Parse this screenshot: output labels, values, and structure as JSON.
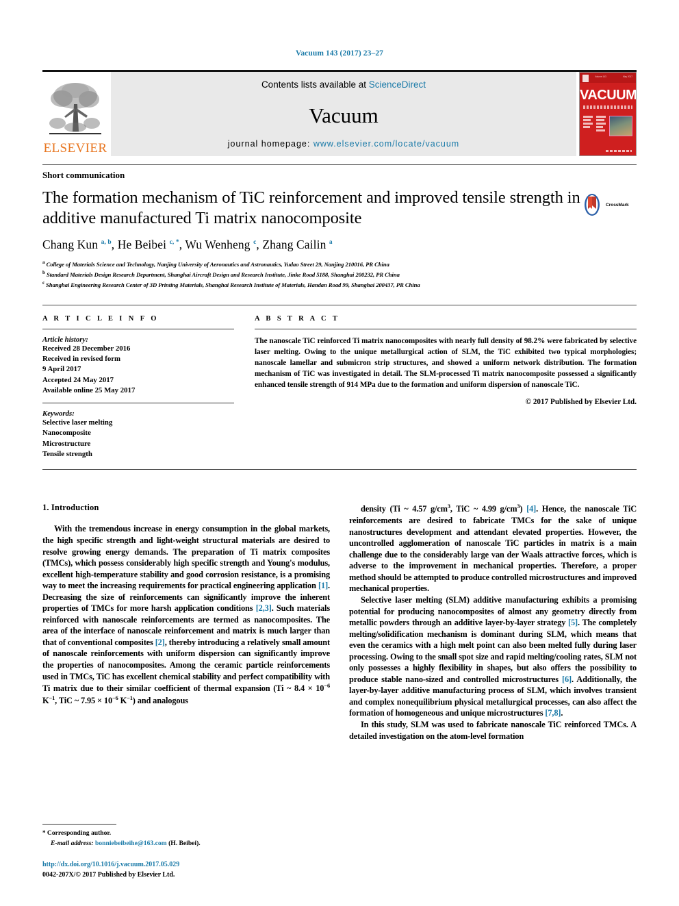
{
  "masthead": {
    "citation": "Vacuum 143 (2017) 23–27"
  },
  "journal_header": {
    "publisher_name": "ELSEVIER",
    "contents_prefix": "Contents lists available at ",
    "sciencedirect": "ScienceDirect",
    "journal_title": "Vacuum",
    "homepage_label": "journal homepage: ",
    "homepage_url": "www.elsevier.com/locate/vacuum",
    "cover_title": "VACUUM",
    "accent_blue": "#1a7aa8",
    "elsevier_orange": "#E87722",
    "cover_red": "#cf1f1f"
  },
  "article": {
    "type": "Short communication",
    "title": "The formation mechanism of TiC reinforcement and improved tensile strength in additive manufactured Ti matrix nanocomposite",
    "crossmark_label": "CrossMark",
    "authors_html": "Chang Kun <sup>a, b</sup>, He Beibei <sup>c, *</sup>, Wu Wenheng <sup>c</sup>, Zhang Cailin <sup>a</sup>",
    "affiliations": [
      {
        "marker": "a",
        "text": "College of Materials Science and Technology, Nanjing University of Aeronautics and Astronautics, Yudao Street 29, Nanjing 210016, PR China"
      },
      {
        "marker": "b",
        "text": "Standard Materials Design Research Department, Shanghai Aircraft Design and Research Institute, Jinke Road 5188, Shanghai 200232, PR China"
      },
      {
        "marker": "c",
        "text": "Shanghai Engineering Research Center of 3D Printing Materials, Shanghai Research Institute of Materials, Handan Road 99, Shanghai 200437, PR China"
      }
    ]
  },
  "article_info": {
    "heading": "A R T I C L E  I N F O",
    "history_label": "Article history:",
    "history": [
      "Received 28 December 2016",
      "Received in revised form",
      "9 April 2017",
      "Accepted 24 May 2017",
      "Available online 25 May 2017"
    ],
    "keywords_label": "Keywords:",
    "keywords": [
      "Selective laser melting",
      "Nanocomposite",
      "Microstructure",
      "Tensile strength"
    ]
  },
  "abstract": {
    "heading": "A B S T R A C T",
    "text": "The nanoscale TiC reinforced Ti matrix nanocomposites with nearly full density of 98.2% were fabricated by selective laser melting. Owing to the unique metallurgical action of SLM, the TiC exhibited two typical morphologies; nanoscale lamellar and submicron strip structures, and showed a uniform network distribution. The formation mechanism of TiC was investigated in detail. The SLM-processed Ti matrix nanocomposite possessed a significantly enhanced tensile strength of 914 MPa due to the formation and uniform dispersion of nanoscale TiC.",
    "copyright": "© 2017 Published by Elsevier Ltd."
  },
  "body": {
    "section_number_title": "1.  Introduction",
    "left_paragraph_1_html": "With the tremendous increase in energy consumption in the global markets, the high specific strength and light-weight structural materials are desired to resolve growing energy demands. The preparation of Ti matrix composites (TMCs), which possess considerably high specific strength and Young's modulus, excellent high-temperature stability and good corrosion resistance, is a promising way to meet the increasing requirements for practical engineering application <span class=\"ref\">[1]</span>. Decreasing the size of reinforcements can significantly improve the inherent properties of TMCs for more harsh application conditions <span class=\"ref\">[2,3]</span>. Such materials reinforced with nanoscale reinforcements are termed as nanocomposites. The area of the interface of nanoscale reinforcement and matrix is much larger than that of conventional composites <span class=\"ref\">[2]</span>, thereby introducing a relatively small amount of nanoscale reinforcements with uniform dispersion can significantly improve the properties of nanocomposites. Among the ceramic particle reinforcements used in TMCs, TiC has excellent chemical stability and perfect compatibility with Ti matrix due to their similar coefficient of thermal expansion (Ti ~ 8.4 &#215; 10<sup>&#8722;6</sup> K<sup>&#8722;1</sup>, TiC ~ 7.95 &#215; 10<sup>&#8722;6</sup> K<sup>&#8722;1</sup>) and analogous",
    "right_paragraph_1_html": "density (Ti ~ 4.57 g/cm<sup>3</sup>, TiC ~ 4.99 g/cm<sup>3</sup>) <span class=\"ref\">[4]</span>. Hence, the nanoscale TiC reinforcements are desired to fabricate TMCs for the sake of unique nanostructures development and attendant elevated properties. However, the uncontrolled agglomeration of nanoscale TiC particles in matrix is a main challenge due to the considerably large van der Waals attractive forces, which is adverse to the improvement in mechanical properties. Therefore, a proper method should be attempted to produce controlled microstructures and improved mechanical properties.",
    "right_paragraph_2_html": "Selective laser melting (SLM) additive manufacturing exhibits a promising potential for producing nanocomposites of almost any geometry directly from metallic powders through an additive layer-by-layer strategy <span class=\"ref\">[5]</span>. The completely melting/solidification mechanism is dominant during SLM, which means that even the ceramics with a high melt point can also been melted fully during laser processing. Owing to the small spot size and rapid melting/cooling rates, SLM not only possesses a highly flexibility in shapes, but also offers the possibility to produce stable nano-sized and controlled microstructures <span class=\"ref\">[6]</span>. Additionally, the layer-by-layer additive manufacturing process of SLM, which involves transient and complex nonequilibrium physical metallurgical processes, can also affect the formation of homogeneous and unique microstructures <span class=\"ref\">[7,8]</span>.",
    "right_paragraph_3_html": "In this study, SLM was used to fabricate nanoscale TiC reinforced TMCs. A detailed investigation on the atom-level formation"
  },
  "footer": {
    "corresponding_author": "Corresponding author.",
    "email_label": "E-mail address:",
    "email": "bonniebeibeihe@163.com",
    "email_owner": "(H. Beibei).",
    "doi": "http://dx.doi.org/10.1016/j.vacuum.2017.05.029",
    "issn_line": "0042-207X/© 2017 Published by Elsevier Ltd."
  }
}
